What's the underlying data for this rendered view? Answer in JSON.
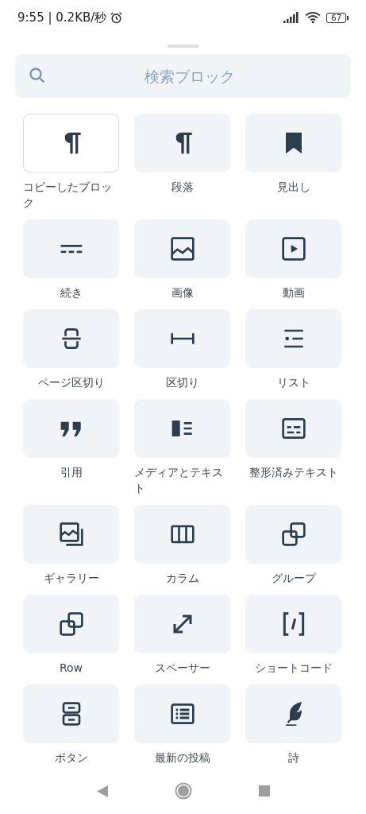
{
  "status_bar": {
    "time_and_speed": "9:55 | 0.2KB/秒",
    "battery": "67"
  },
  "search": {
    "placeholder": "検索ブロック"
  },
  "blocks": [
    {
      "label": "コピーしたブロック",
      "kind": "paragraph",
      "outlined": true
    },
    {
      "label": "段落",
      "kind": "paragraph",
      "outlined": false
    },
    {
      "label": "見出し",
      "kind": "bookmark",
      "outlined": false
    },
    {
      "label": "続き",
      "kind": "more",
      "outlined": false
    },
    {
      "label": "画像",
      "kind": "image",
      "outlined": false
    },
    {
      "label": "動画",
      "kind": "video",
      "outlined": false
    },
    {
      "label": "ページ区切り",
      "kind": "pagebreak",
      "outlined": false
    },
    {
      "label": "区切り",
      "kind": "separator",
      "outlined": false
    },
    {
      "label": "リスト",
      "kind": "list",
      "outlined": false
    },
    {
      "label": "引用",
      "kind": "quote",
      "outlined": false
    },
    {
      "label": "メディアとテキスト",
      "kind": "mediatext",
      "outlined": false
    },
    {
      "label": "整形済みテキスト",
      "kind": "preformatted",
      "outlined": false
    },
    {
      "label": "ギャラリー",
      "kind": "gallery",
      "outlined": false
    },
    {
      "label": "カラム",
      "kind": "columns",
      "outlined": false
    },
    {
      "label": "グループ",
      "kind": "group",
      "outlined": false
    },
    {
      "label": "Row",
      "kind": "group",
      "outlined": false
    },
    {
      "label": "スペーサー",
      "kind": "spacer",
      "outlined": false
    },
    {
      "label": "ショートコード",
      "kind": "shortcode",
      "outlined": false
    },
    {
      "label": "ボタン",
      "kind": "buttons",
      "outlined": false
    },
    {
      "label": "最新の投稿",
      "kind": "posts",
      "outlined": false
    },
    {
      "label": "詩",
      "kind": "verse",
      "outlined": false
    }
  ]
}
